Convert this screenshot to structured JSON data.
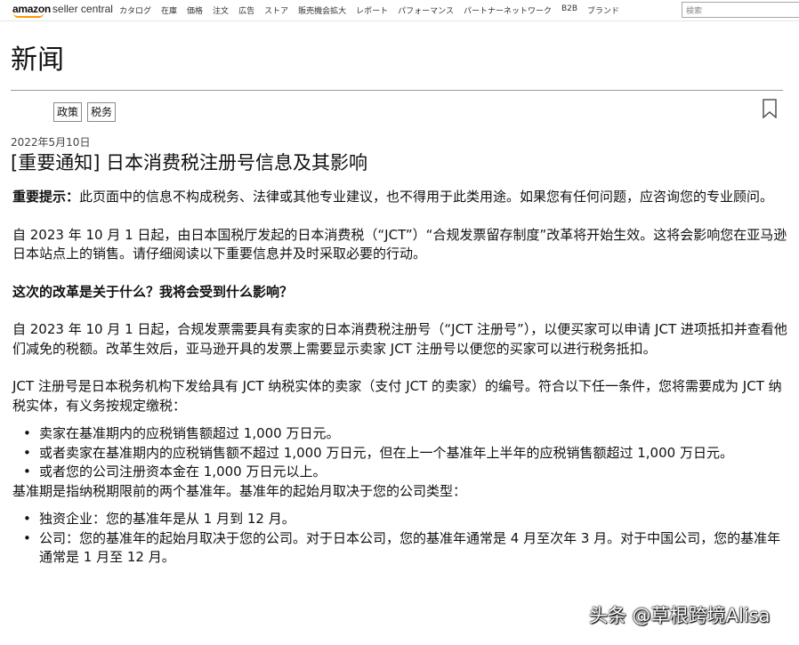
{
  "header": {
    "logo_amazon": "amazon",
    "logo_sc": "seller central",
    "nav": [
      "カタログ",
      "在庫",
      "価格",
      "注文",
      "広告",
      "ストア",
      "販売機会拡大",
      "レポート",
      "パフォーマンス",
      "パートナーネットワーク",
      "B2B",
      "ブランド"
    ],
    "search_placeholder": "検索"
  },
  "page": {
    "title": "新闻",
    "tags": [
      "政策",
      "税务"
    ],
    "date": "2022年5月10日",
    "article_title": "[重要通知] 日本消费税注册号信息及其影响"
  },
  "article": {
    "p1_strong": "重要提示：",
    "p1_rest": "此页面中的信息不构成税务、法律或其他专业建议，也不得用于此类用途。如果您有任何问题，应咨询您的专业顾问。",
    "p2": "自 2023 年 10 月 1 日起，由日本国税厅发起的日本消费税（“JCT”）“合规发票留存制度”改革将开始生效。这将会影响您在亚马逊日本站点上的销售。请仔细阅读以下重要信息并及时采取必要的行动。",
    "h1": "这次的改革是关于什么？我将会受到什么影响？",
    "p3": "自 2023 年 10 月 1 日起，合规发票需要具有卖家的日本消费税注册号（“JCT 注册号”），以便买家可以申请 JCT 进项抵扣并查看他们减免的税额。改革生效后，亚马逊开具的发票上需要显示卖家 JCT 注册号以便您的买家可以进行税务抵扣。",
    "p4": "JCT 注册号是日本税务机构下发给具有 JCT 纳税实体的卖家（支付 JCT 的卖家）的编号。符合以下任一条件，您将需要成为 JCT 纳税实体，有义务按规定缴税：",
    "list1": [
      "卖家在基准期内的应税销售额超过 1,000 万日元。",
      "或者卖家在基准期内的应税销售额不超过 1,000 万日元，但在上一个基准年上半年的应税销售额超过 1,000 万日元。",
      "或者您的公司注册资本金在 1,000 万日元以上。"
    ],
    "p5": "基准期是指纳税期限前的两个基准年。基准年的起始月取决于您的公司类型：",
    "list2": [
      "独资企业：您的基准年是从 1 月到 12 月。",
      "公司：您的基准年的起始月取决于您的公司。对于日本公司，您的基准年通常是 4 月至次年 3 月。对于中国公司，您的基准年通常是 1 月至 12 月。"
    ]
  },
  "watermark": "头条 @草根跨境Alisa"
}
